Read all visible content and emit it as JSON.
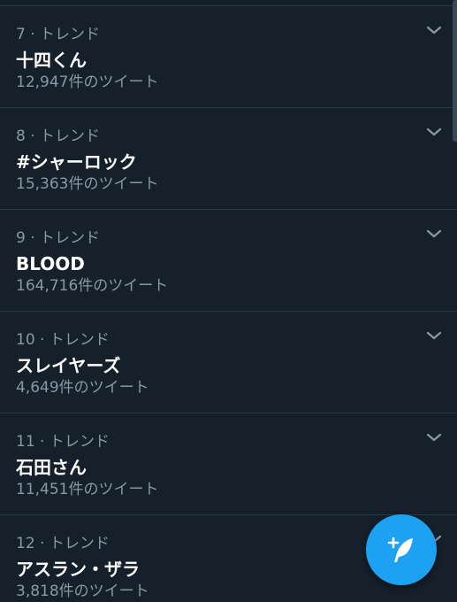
{
  "trends": [
    {
      "rank": "7",
      "category": "トレンド",
      "name": "十四くん",
      "count": "12,947件のツイート"
    },
    {
      "rank": "8",
      "category": "トレンド",
      "name": "#シャーロック",
      "count": "15,363件のツイート"
    },
    {
      "rank": "9",
      "category": "トレンド",
      "name": "BLOOD",
      "count": "164,716件のツイート"
    },
    {
      "rank": "10",
      "category": "トレンド",
      "name": "スレイヤーズ",
      "count": "4,649件のツイート"
    },
    {
      "rank": "11",
      "category": "トレンド",
      "name": "石田さん",
      "count": "11,451件のツイート"
    },
    {
      "rank": "12",
      "category": "トレンド",
      "name": "アスラン・ザラ",
      "count": "3,818件のツイート"
    }
  ],
  "icons": {
    "item_menu": "chevron-down-icon",
    "compose": "compose-tweet-icon"
  },
  "colors": {
    "background": "#15202b",
    "divider": "#2b3844",
    "secondary_text": "#8899a6",
    "primary_text": "#ffffff",
    "accent": "#1da1f2"
  }
}
